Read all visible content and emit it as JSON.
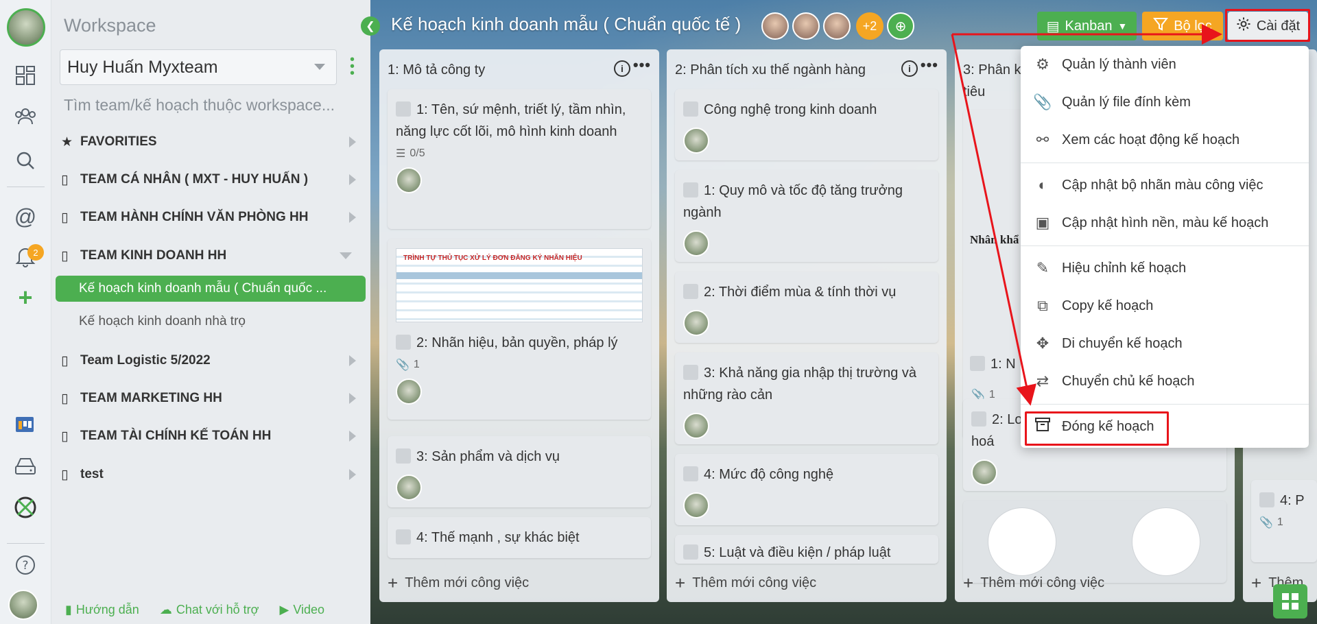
{
  "workspace": {
    "title": "Workspace",
    "selected": "Huy Huấn Myxteam",
    "search_placeholder": "Tìm team/kế hoạch thuộc workspace...",
    "items": [
      {
        "label": "FAVORITIES",
        "icon": "star-icon"
      },
      {
        "label": "TEAM CÁ NHÂN ( MXT - HUY HUẤN )",
        "icon": "book-icon"
      },
      {
        "label": "TEAM HÀNH CHÍNH VĂN PHÒNG HH",
        "icon": "book-icon"
      },
      {
        "label": "TEAM KINH DOANH HH",
        "icon": "book-icon"
      },
      {
        "label": "Team Logistic 5/2022",
        "icon": "book-icon"
      },
      {
        "label": "TEAM MARKETING HH",
        "icon": "book-icon"
      },
      {
        "label": "TEAM TÀI CHÍNH KẾ TOÁN HH",
        "icon": "book-icon"
      },
      {
        "label": "test",
        "icon": "book-icon"
      }
    ],
    "sub_items": [
      {
        "label": "Kế hoạch kinh doanh mẫu ( Chuẩn quốc ...",
        "active": true
      },
      {
        "label": "Kế hoạch kinh doanh nhà trọ",
        "active": false
      }
    ],
    "footer": {
      "guide": "Hướng dẫn",
      "chat": "Chat với hỗ trợ",
      "video": "Video"
    }
  },
  "rail": {
    "notification_count": "2"
  },
  "board": {
    "title": "Kế hoạch kinh doanh mẫu ( Chuẩn quốc tế )",
    "extra_members": "+2",
    "kanban_label": "Kanban",
    "filter_label": "Bộ lọc",
    "settings_label": "Cài đặt"
  },
  "columns": [
    {
      "title": "1: Mô tả công ty",
      "cards": [
        {
          "title": "1: Tên, sứ mệnh, triết lý, tầm nhìn, năng lực cốt lõi, mô hình kinh doanh",
          "checklist": "0/5"
        },
        {
          "title": "2: Nhãn hiệu, bản quyền, pháp lý",
          "attachments": "1",
          "thumb_text": "TRÌNH TỰ THỦ TỤC XỬ LÝ ĐƠN ĐĂNG KÝ NHÃN HIỆU"
        },
        {
          "title": "3: Sản phẩm và dịch vụ"
        },
        {
          "title": "4: Thế mạnh , sự khác biệt"
        }
      ],
      "add_label": "Thêm mới công việc"
    },
    {
      "title": "2: Phân tích xu thế ngành hàng",
      "cards": [
        {
          "title": "Công nghệ trong kinh doanh"
        },
        {
          "title": "1: Quy mô và tốc độ tăng trưởng ngành"
        },
        {
          "title": "2: Thời điểm mùa & tính thời vụ"
        },
        {
          "title": "3: Khả năng gia nhập thị trường và những rào cản"
        },
        {
          "title": "4: Mức độ công nghệ"
        },
        {
          "title": "5: Luật và điều kiện / pháp luật"
        }
      ],
      "add_label": "Thêm mới công việc"
    },
    {
      "title": "3: Phân k",
      "title_line2": "tiêu",
      "cards": [
        {
          "title": "1: N",
          "attachments": "1"
        },
        {
          "title": "2: Lo",
          "title_line2": "hoá"
        }
      ],
      "add_label": "Thêm mới công việc"
    },
    {
      "title": "",
      "cards": [
        {
          "title": "4: P",
          "attachments": "1"
        }
      ],
      "add_label": "Thêm"
    }
  ],
  "menu": {
    "items": [
      {
        "label": "Quản lý thành viên",
        "icon": "users-gear-icon"
      },
      {
        "label": "Quản lý file đính kèm",
        "icon": "paperclip-icon"
      },
      {
        "label": "Xem các hoạt động kế hoạch",
        "icon": "activity-icon"
      },
      {
        "label": "Cập nhật bộ nhãn màu công việc",
        "icon": "palette-icon"
      },
      {
        "label": "Cập nhật hình nền, màu kế hoạch",
        "icon": "image-icon"
      },
      {
        "label": "Hiệu chỉnh kế hoạch",
        "icon": "edit-tools-icon"
      },
      {
        "label": "Copy kế hoạch",
        "icon": "copy-icon"
      },
      {
        "label": "Di chuyển kế hoạch",
        "icon": "move-icon"
      },
      {
        "label": "Chuyển chủ kế hoạch",
        "icon": "transfer-owner-icon"
      },
      {
        "label": "Đóng kế hoạch",
        "icon": "archive-box-icon"
      }
    ]
  },
  "colors": {
    "accent": "#4caf50",
    "warning": "#f5a623",
    "highlight": "#e8141b"
  }
}
